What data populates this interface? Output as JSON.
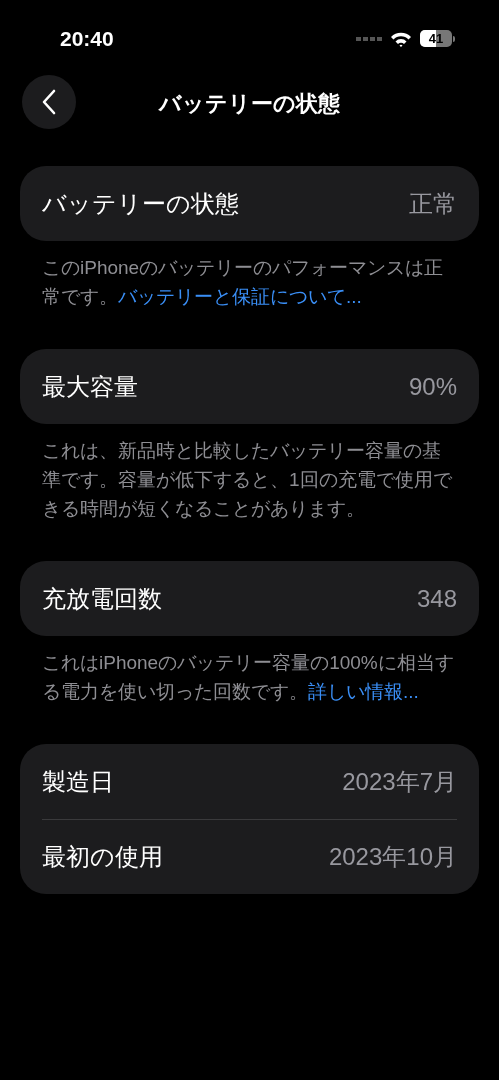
{
  "status_bar": {
    "time": "20:40",
    "battery": "41"
  },
  "nav": {
    "title": "バッテリーの状態"
  },
  "sections": [
    {
      "rows": [
        {
          "label": "バッテリーの状態",
          "value": "正常"
        }
      ],
      "footer": {
        "text": "このiPhoneのバッテリーのパフォーマンスは正常です。",
        "link": "バッテリーと保証について..."
      }
    },
    {
      "rows": [
        {
          "label": "最大容量",
          "value": "90%"
        }
      ],
      "footer": {
        "text": "これは、新品時と比較したバッテリー容量の基準です。容量が低下すると、1回の充電で使用できる時間が短くなることがあります。"
      }
    },
    {
      "rows": [
        {
          "label": "充放電回数",
          "value": "348"
        }
      ],
      "footer": {
        "text": "これはiPhoneのバッテリー容量の100%に相当する電力を使い切った回数です。",
        "link": "詳しい情報..."
      }
    },
    {
      "rows": [
        {
          "label": "製造日",
          "value": "2023年7月"
        },
        {
          "label": "最初の使用",
          "value": "2023年10月"
        }
      ]
    }
  ]
}
